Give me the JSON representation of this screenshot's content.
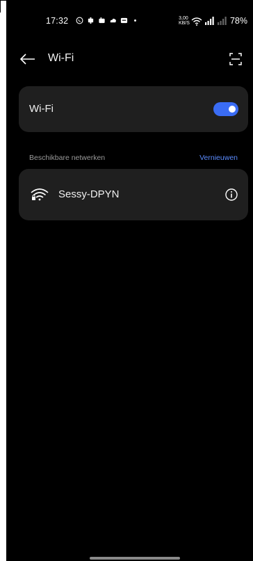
{
  "status_bar": {
    "time": "17:32",
    "speed_top": "3,00",
    "speed_bottom": "KB/S",
    "battery": "78%"
  },
  "app_bar": {
    "title": "Wi-Fi"
  },
  "wifi_toggle": {
    "label": "Wi-Fi",
    "enabled": true
  },
  "networks_section": {
    "header": "Beschikbare netwerken",
    "refresh_label": "Vernieuwen"
  },
  "networks": [
    {
      "name": "Sessy-DPYN",
      "icon": "wifi-lock-icon"
    }
  ],
  "colors": {
    "background": "#000000",
    "card": "#1f1f1f",
    "accent": "#3a6cf4",
    "link": "#5b8cff"
  }
}
